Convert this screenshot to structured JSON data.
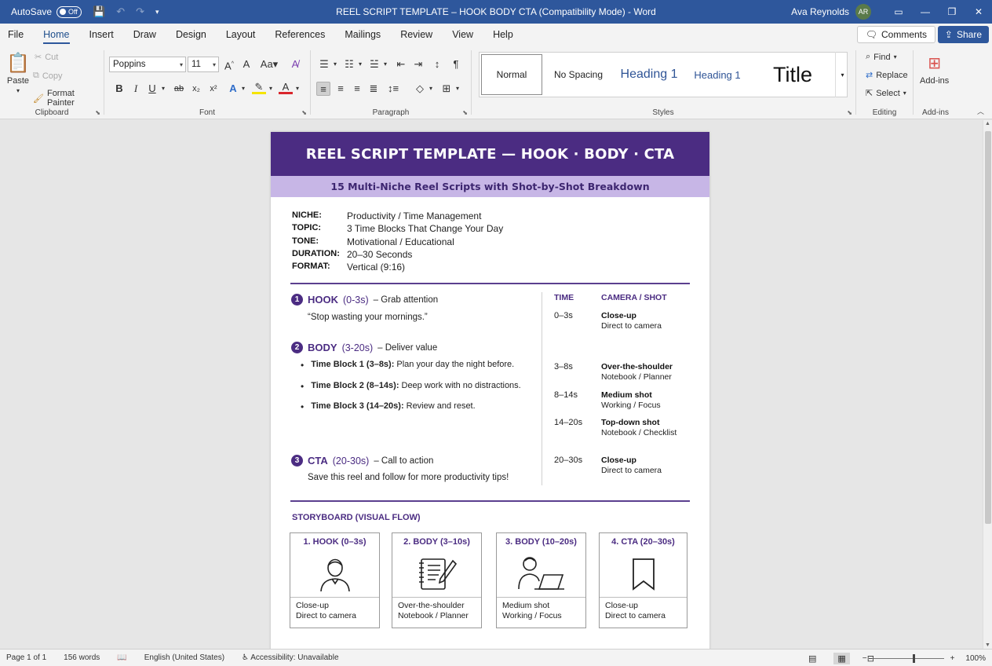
{
  "titlebar": {
    "autosave_label": "AutoSave",
    "autosave_state": "Off",
    "document_title": "REEL SCRIPT TEMPLATE – HOOK BODY CTA (Compatibility Mode)  -  Word",
    "user_name": "Ava Reynolds",
    "user_initials": "AR"
  },
  "menu": {
    "tabs": [
      "File",
      "Home",
      "Insert",
      "Draw",
      "Design",
      "Layout",
      "References",
      "Mailings",
      "Review",
      "View",
      "Help"
    ],
    "active": "Home",
    "comments_label": "Comments",
    "share_label": "Share"
  },
  "ribbon": {
    "clipboard": {
      "paste": "Paste",
      "cut": "Cut",
      "copy": "Copy",
      "format_painter": "Format Painter",
      "label": "Clipboard"
    },
    "font": {
      "family": "Poppins",
      "size": "11",
      "label": "Font"
    },
    "paragraph": {
      "label": "Paragraph"
    },
    "styles": {
      "items": [
        "Normal",
        "No Spacing",
        "Heading 1",
        "Heading 1",
        "Title"
      ],
      "label": "Styles"
    },
    "editing": {
      "find": "Find",
      "replace": "Replace",
      "select": "Select",
      "label": "Editing"
    },
    "addins": {
      "button": "Add-ins",
      "label": "Add-ins"
    }
  },
  "document": {
    "banner": "REEL SCRIPT TEMPLATE — HOOK · BODY · CTA",
    "subbanner": "15 Multi-Niche Reel Scripts with Shot-by-Shot Breakdown",
    "meta": [
      {
        "key": "NICHE:",
        "value": "Productivity / Time Management"
      },
      {
        "key": "TOPIC:",
        "value": "3 Time Blocks That Change Your Day"
      },
      {
        "key": "TONE:",
        "value": "Motivational / Educational"
      },
      {
        "key": "DURATION:",
        "value": "20–30 Seconds"
      },
      {
        "key": "FORMAT:",
        "value": "Vertical (9:16)"
      }
    ],
    "hook": {
      "num": "1",
      "title": "HOOK",
      "time": "(0-3s)",
      "desc": "– Grab attention",
      "text": "“Stop wasting your mornings.”"
    },
    "body": {
      "num": "2",
      "title": "BODY",
      "time": "(3-20s)",
      "desc": "– Deliver value",
      "bullets": [
        {
          "label": "Time Block 1 (3–8s):",
          "text": "Plan your day the night before."
        },
        {
          "label": "Time Block 2 (8–14s):",
          "text": "Deep work with no distractions."
        },
        {
          "label": "Time Block 3 (14–20s):",
          "text": "Review and reset."
        }
      ]
    },
    "cta": {
      "num": "3",
      "title": "CTA",
      "time": "(20-30s)",
      "desc": "– Call to action",
      "text": "Save this reel and follow for more productivity tips!"
    },
    "shots": {
      "head_time": "TIME",
      "head_camera": "CAMERA / SHOT",
      "rows": [
        {
          "time": "0–3s",
          "shot": "Close-up",
          "detail": "Direct to camera"
        },
        {
          "time": "3–8s",
          "shot": "Over-the-shoulder",
          "detail": "Notebook / Planner"
        },
        {
          "time": "8–14s",
          "shot": "Medium shot",
          "detail": "Working / Focus"
        },
        {
          "time": "14–20s",
          "shot": "Top-down shot",
          "detail": "Notebook / Checklist"
        },
        {
          "time": "20–30s",
          "shot": "Close-up",
          "detail": "Direct to camera"
        }
      ]
    },
    "storyboard": {
      "title": "STORYBOARD (VISUAL FLOW)",
      "cards": [
        {
          "title": "1. HOOK (0–3s)",
          "icon": "person-icon",
          "line1": "Close-up",
          "line2": "Direct to camera"
        },
        {
          "title": "2. BODY (3–10s)",
          "icon": "notebook-pen-icon",
          "line1": "Over-the-shoulder",
          "line2": "Notebook / Planner"
        },
        {
          "title": "3. BODY (10–20s)",
          "icon": "person-laptop-icon",
          "line1": "Medium shot",
          "line2": "Working / Focus"
        },
        {
          "title": "4. CTA (20–30s)",
          "icon": "bookmark-icon",
          "line1": "Close-up",
          "line2": "Direct to camera"
        }
      ]
    }
  },
  "status": {
    "page": "Page 1 of 1",
    "words": "156 words",
    "language": "English (United States)",
    "accessibility": "Accessibility: Unavailable",
    "zoom": "100%"
  },
  "colors": {
    "titlebar": "#2e579c",
    "accent": "#4b2c82",
    "subbanner": "#c7b6e6"
  }
}
